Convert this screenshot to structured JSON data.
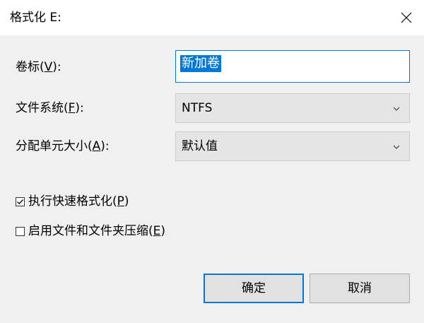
{
  "window": {
    "title": "格式化 E:"
  },
  "form": {
    "volume_label": {
      "label": "卷标(",
      "accel": "V",
      "label_end": "):",
      "value": "新加卷"
    },
    "file_system": {
      "label": "文件系统(",
      "accel": "F",
      "label_end": "):",
      "value": "NTFS"
    },
    "allocation_unit": {
      "label": "分配单元大小(",
      "accel": "A",
      "label_end": "):",
      "value": "默认值"
    }
  },
  "options": {
    "quick_format": {
      "label": "执行快速格式化(",
      "accel": "P",
      "label_end": ")",
      "checked": true
    },
    "compression": {
      "label": "启用文件和文件夹压缩(",
      "accel": "E",
      "label_end": ")",
      "checked": false
    }
  },
  "buttons": {
    "ok_label": "确定",
    "cancel_label": "取消"
  },
  "icons": {
    "close": "close-icon",
    "dropdown": "chevron-down-icon",
    "checkmark": "checkmark-icon"
  },
  "colors": {
    "accent": "#0078d7",
    "dialog_bg": "#f0f0f0",
    "combo_bg": "#e5e5e5",
    "button_bg": "#e1e1e1"
  }
}
